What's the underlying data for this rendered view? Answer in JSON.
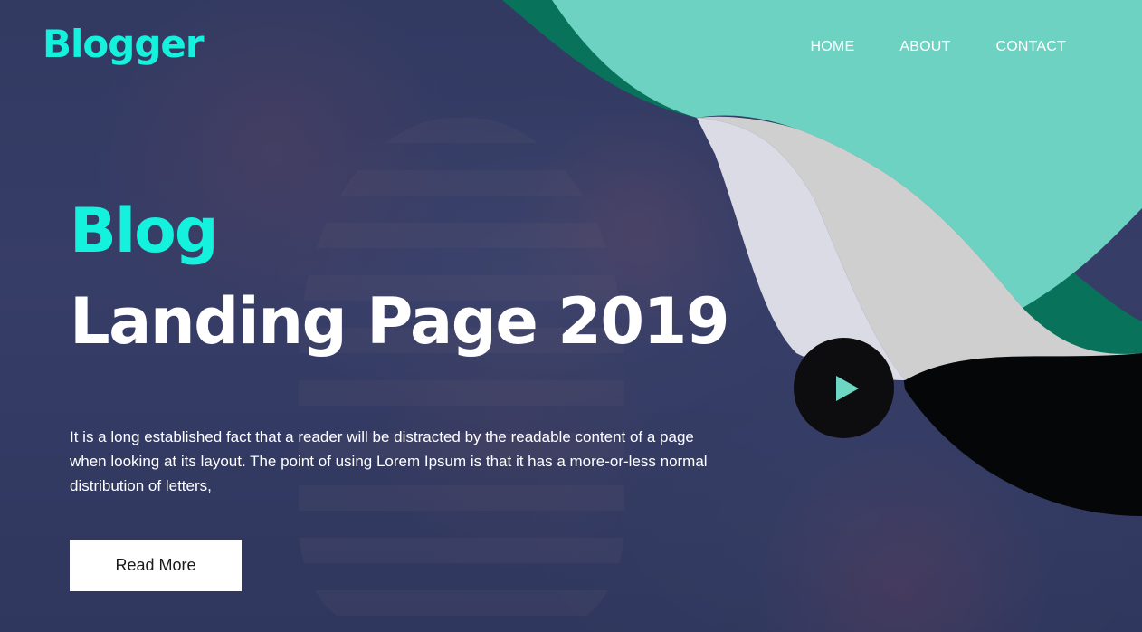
{
  "brand": {
    "name": "Blogger"
  },
  "nav": {
    "items": [
      {
        "label": "HOME"
      },
      {
        "label": "ABOUT"
      },
      {
        "label": "CONTACT"
      }
    ]
  },
  "hero": {
    "subtitle": "Blog",
    "title": "Landing Page 2019",
    "description": "It is a long established fact that a reader will be distracted by the readable content of a page when looking at its layout. The point of using Lorem Ipsum is that it has a more-or-less normal distribution of letters,",
    "cta_label": "Read More"
  },
  "icons": {
    "play": "play-icon"
  },
  "colors": {
    "accent": "#14f2de",
    "background": "#343a63",
    "teal": "#6ed2c2",
    "dark_green": "#08725b",
    "silver": "#cfcfcf",
    "lavender": "#dadbe5",
    "black": "#050607"
  }
}
